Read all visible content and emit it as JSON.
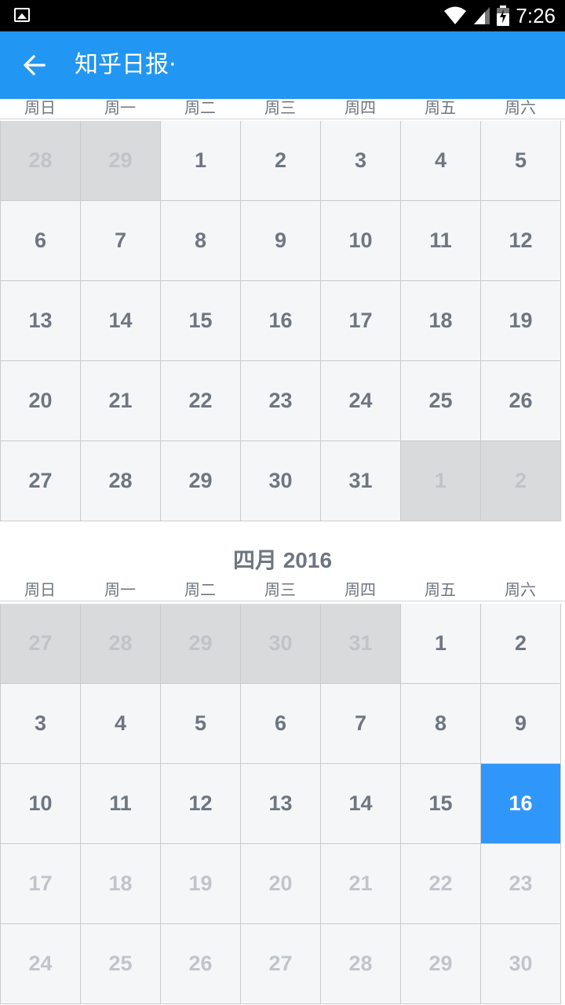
{
  "status_bar": {
    "time": "7:26"
  },
  "app_bar": {
    "title": "知乎日报·"
  },
  "weekdays": [
    "周日",
    "周一",
    "周二",
    "周三",
    "周四",
    "周五",
    "周六"
  ],
  "months": [
    {
      "title": "",
      "weeks": [
        [
          {
            "d": "28",
            "s": "other"
          },
          {
            "d": "29",
            "s": "other"
          },
          {
            "d": "1",
            "s": "normal"
          },
          {
            "d": "2",
            "s": "normal"
          },
          {
            "d": "3",
            "s": "normal"
          },
          {
            "d": "4",
            "s": "normal"
          },
          {
            "d": "5",
            "s": "normal"
          }
        ],
        [
          {
            "d": "6",
            "s": "normal"
          },
          {
            "d": "7",
            "s": "normal"
          },
          {
            "d": "8",
            "s": "normal"
          },
          {
            "d": "9",
            "s": "normal"
          },
          {
            "d": "10",
            "s": "normal"
          },
          {
            "d": "11",
            "s": "normal"
          },
          {
            "d": "12",
            "s": "normal"
          }
        ],
        [
          {
            "d": "13",
            "s": "normal"
          },
          {
            "d": "14",
            "s": "normal"
          },
          {
            "d": "15",
            "s": "normal"
          },
          {
            "d": "16",
            "s": "normal"
          },
          {
            "d": "17",
            "s": "normal"
          },
          {
            "d": "18",
            "s": "normal"
          },
          {
            "d": "19",
            "s": "normal"
          }
        ],
        [
          {
            "d": "20",
            "s": "normal"
          },
          {
            "d": "21",
            "s": "normal"
          },
          {
            "d": "22",
            "s": "normal"
          },
          {
            "d": "23",
            "s": "normal"
          },
          {
            "d": "24",
            "s": "normal"
          },
          {
            "d": "25",
            "s": "normal"
          },
          {
            "d": "26",
            "s": "normal"
          }
        ],
        [
          {
            "d": "27",
            "s": "normal"
          },
          {
            "d": "28",
            "s": "normal"
          },
          {
            "d": "29",
            "s": "normal"
          },
          {
            "d": "30",
            "s": "normal"
          },
          {
            "d": "31",
            "s": "normal"
          },
          {
            "d": "1",
            "s": "other"
          },
          {
            "d": "2",
            "s": "other"
          }
        ]
      ]
    },
    {
      "title": "四月 2016",
      "weeks": [
        [
          {
            "d": "27",
            "s": "other"
          },
          {
            "d": "28",
            "s": "other"
          },
          {
            "d": "29",
            "s": "other"
          },
          {
            "d": "30",
            "s": "other"
          },
          {
            "d": "31",
            "s": "other"
          },
          {
            "d": "1",
            "s": "normal"
          },
          {
            "d": "2",
            "s": "normal"
          }
        ],
        [
          {
            "d": "3",
            "s": "normal"
          },
          {
            "d": "4",
            "s": "normal"
          },
          {
            "d": "5",
            "s": "normal"
          },
          {
            "d": "6",
            "s": "normal"
          },
          {
            "d": "7",
            "s": "normal"
          },
          {
            "d": "8",
            "s": "normal"
          },
          {
            "d": "9",
            "s": "normal"
          }
        ],
        [
          {
            "d": "10",
            "s": "normal"
          },
          {
            "d": "11",
            "s": "normal"
          },
          {
            "d": "12",
            "s": "normal"
          },
          {
            "d": "13",
            "s": "normal"
          },
          {
            "d": "14",
            "s": "normal"
          },
          {
            "d": "15",
            "s": "normal"
          },
          {
            "d": "16",
            "s": "selected"
          }
        ],
        [
          {
            "d": "17",
            "s": "future"
          },
          {
            "d": "18",
            "s": "future"
          },
          {
            "d": "19",
            "s": "future"
          },
          {
            "d": "20",
            "s": "future"
          },
          {
            "d": "21",
            "s": "future"
          },
          {
            "d": "22",
            "s": "future"
          },
          {
            "d": "23",
            "s": "future"
          }
        ],
        [
          {
            "d": "24",
            "s": "future"
          },
          {
            "d": "25",
            "s": "future"
          },
          {
            "d": "26",
            "s": "future"
          },
          {
            "d": "27",
            "s": "future"
          },
          {
            "d": "28",
            "s": "future"
          },
          {
            "d": "29",
            "s": "future"
          },
          {
            "d": "30",
            "s": "future"
          }
        ]
      ]
    }
  ],
  "colors": {
    "primary": "#2196f3",
    "selected": "#2f96fa",
    "cell_bg": "#f5f6f8",
    "other_month_bg": "#d9dadc"
  }
}
